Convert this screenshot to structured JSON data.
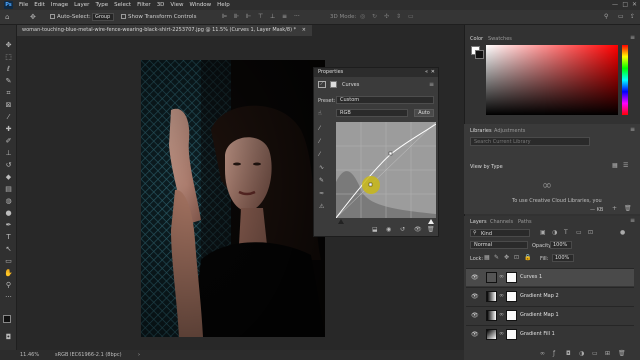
{
  "menu": {
    "logo": "Ps",
    "items": [
      "File",
      "Edit",
      "Image",
      "Layer",
      "Type",
      "Select",
      "Filter",
      "3D",
      "View",
      "Window",
      "Help"
    ]
  },
  "options": {
    "auto_select_label": "Auto-Select:",
    "auto_select_value": "Group",
    "transform_label": "Show Transform Controls",
    "mode_3d_label": "3D Mode:"
  },
  "document": {
    "tab_title": "woman-touching-blue-metal-wire-fence-wearing-black-shirt-2253707.jpg @ 11.5% (Curves 1, Layer Mask/8) *",
    "tab_close": "×"
  },
  "status": {
    "zoom": "11.46%",
    "profile": "sRGB IEC61966-2.1 (8bpc)",
    "arrow": "›"
  },
  "properties": {
    "title": "Properties",
    "adjustment_name": "Curves",
    "preset_label": "Preset:",
    "preset_value": "Custom",
    "channel_value": "RGB",
    "auto_button": "Auto"
  },
  "color_panel": {
    "tab_color": "Color",
    "tab_swatches": "Swatches",
    "hue_color": "#ff0000"
  },
  "libraries": {
    "tab_libraries": "Libraries",
    "tab_adjustments": "Adjustments",
    "search_placeholder": "Search Current Library",
    "view_by": "View by Type",
    "cloud_text": "To use Creative Cloud Libraries, you",
    "size_label": "— KB"
  },
  "layers": {
    "tab_layers": "Layers",
    "tab_channels": "Channels",
    "tab_paths": "Paths",
    "kind_label": "Kind",
    "blend_mode": "Normal",
    "opacity_label": "Opacity:",
    "opacity_value": "100%",
    "lock_label": "Lock:",
    "fill_label": "Fill:",
    "fill_value": "100%",
    "items": [
      {
        "name": "Curves 1",
        "selected": true
      },
      {
        "name": "Gradient Map 2",
        "selected": false
      },
      {
        "name": "Gradient Map 1",
        "selected": false
      },
      {
        "name": "Gradient Fill 1",
        "selected": false
      }
    ]
  },
  "colors": {
    "highlight": "#c9b818",
    "selected_layer": "#454545"
  }
}
